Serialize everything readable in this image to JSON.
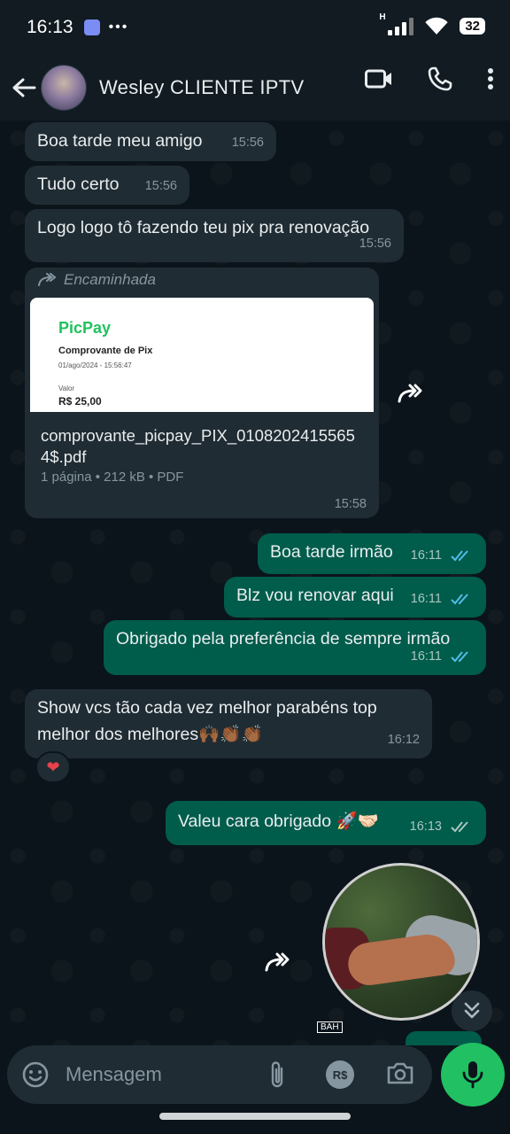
{
  "status_bar": {
    "time": "16:13",
    "dots": "•••",
    "network": "H",
    "battery": "32"
  },
  "header": {
    "contact_name": "Wesley CLIENTE IPTV"
  },
  "messages": [
    {
      "text": "Boa tarde meu amigo",
      "time": "15:56"
    },
    {
      "text": "Tudo certo",
      "time": "15:56"
    },
    {
      "text": "Logo logo tô fazendo teu pix pra renovação",
      "time": "15:56"
    }
  ],
  "document": {
    "forwarded_label": "Encaminhada",
    "preview": {
      "logo": "PicPay",
      "title": "Comprovante de Pix",
      "date": "01/ago/2024 - 15:56:47",
      "value_label": "Valor",
      "value": "R$ 25,00"
    },
    "file_name": "comprovante_picpay_PIX_01082024155654$.pdf",
    "meta": "1 página • 212 kB • PDF",
    "time": "15:58"
  },
  "outgoing": [
    {
      "text": "Boa tarde irmão",
      "time": "16:11"
    },
    {
      "text": "Blz vou renovar aqui",
      "time": "16:11"
    },
    {
      "text": "Obrigado pela preferência de sempre irmão",
      "time": "16:11"
    }
  ],
  "incoming_long": {
    "line1": "Show vcs tão cada vez melhor parabéns top",
    "line2": "melhor dos melhores🙌🏾👏🏾👏🏾",
    "time": "16:12",
    "reaction": "❤"
  },
  "last_outgoing": {
    "text": "Valeu cara obrigado 🚀🤝🏻",
    "time": "16:13"
  },
  "video_note": {
    "watermark": "BAH"
  },
  "composer": {
    "placeholder": "Mensagem",
    "currency_icon": "R$"
  },
  "colors": {
    "header_bg": "#111b21",
    "chat_bg": "#0b141a",
    "incoming": "#202c33",
    "outgoing": "#005c4b",
    "read_tick": "#53bdeb",
    "accent": "#21c063"
  }
}
